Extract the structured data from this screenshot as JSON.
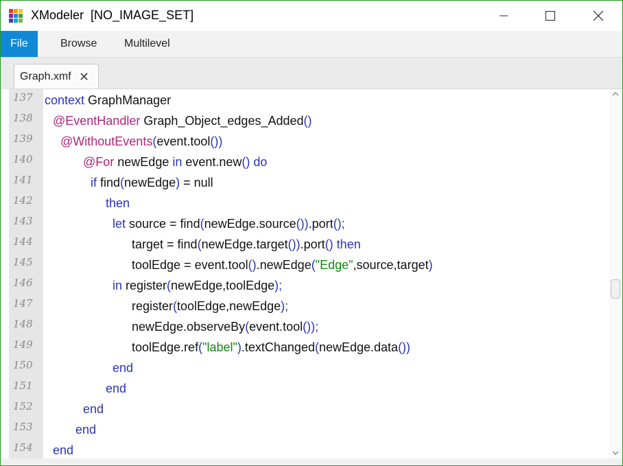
{
  "window": {
    "title": "XModeler  [NO_IMAGE_SET]",
    "accent": "#1e9a1e"
  },
  "menubar": {
    "items": [
      {
        "label": "File",
        "active": true
      },
      {
        "label": "Browse",
        "active": false
      },
      {
        "label": "Multilevel",
        "active": false
      }
    ],
    "active_color": "#1188d6"
  },
  "tabs": [
    {
      "label": "Graph.xmf",
      "close": "✕"
    }
  ],
  "editor": {
    "colors": {
      "keyword": "#2a33b8",
      "annotation": "#b0237a",
      "string": "#118811"
    },
    "lines": [
      {
        "num": "137",
        "tokens": [
          {
            "t": "kw",
            "v": "context "
          },
          {
            "t": "id",
            "v": "GraphManager"
          }
        ]
      },
      {
        "num": "138",
        "tokens": [
          {
            "t": "pk",
            "v": "@EventHandler "
          },
          {
            "t": "id",
            "v": "Graph_Object_edges_Added"
          },
          {
            "t": "kw",
            "v": "()"
          }
        ]
      },
      {
        "num": "139",
        "tokens": [
          {
            "t": "pk",
            "v": "@WithoutEvents"
          },
          {
            "t": "kw",
            "v": "("
          },
          {
            "t": "id",
            "v": "event.tool"
          },
          {
            "t": "kw",
            "v": "())"
          }
        ]
      },
      {
        "num": "140",
        "tokens": [
          {
            "t": "pk",
            "v": "@For "
          },
          {
            "t": "id",
            "v": "newEdge "
          },
          {
            "t": "kw",
            "v": "in "
          },
          {
            "t": "id",
            "v": "event.new"
          },
          {
            "t": "kw",
            "v": "() do"
          }
        ]
      },
      {
        "num": "141",
        "tokens": [
          {
            "t": "kw",
            "v": "if "
          },
          {
            "t": "id",
            "v": "find"
          },
          {
            "t": "kw",
            "v": "("
          },
          {
            "t": "id",
            "v": "newEdge"
          },
          {
            "t": "kw",
            "v": ")"
          },
          {
            "t": "id",
            "v": " = null"
          }
        ]
      },
      {
        "num": "142",
        "tokens": [
          {
            "t": "kw",
            "v": "then"
          }
        ]
      },
      {
        "num": "143",
        "tokens": [
          {
            "t": "kw",
            "v": "let "
          },
          {
            "t": "id",
            "v": "source = find"
          },
          {
            "t": "kw",
            "v": "("
          },
          {
            "t": "id",
            "v": "newEdge.source"
          },
          {
            "t": "kw",
            "v": "())"
          },
          {
            "t": "id",
            "v": ".port"
          },
          {
            "t": "kw",
            "v": "();"
          }
        ]
      },
      {
        "num": "144",
        "tokens": [
          {
            "t": "id",
            "v": "target = find"
          },
          {
            "t": "kw",
            "v": "("
          },
          {
            "t": "id",
            "v": "newEdge.target"
          },
          {
            "t": "kw",
            "v": "())"
          },
          {
            "t": "id",
            "v": ".port"
          },
          {
            "t": "kw",
            "v": "() then"
          }
        ]
      },
      {
        "num": "145",
        "tokens": [
          {
            "t": "id",
            "v": "toolEdge = event.tool"
          },
          {
            "t": "kw",
            "v": "()"
          },
          {
            "t": "id",
            "v": ".newEdge"
          },
          {
            "t": "kw",
            "v": "("
          },
          {
            "t": "str",
            "v": "\"Edge\""
          },
          {
            "t": "id",
            "v": ",source,target"
          },
          {
            "t": "kw",
            "v": ")"
          }
        ]
      },
      {
        "num": "146",
        "tokens": [
          {
            "t": "kw",
            "v": "in "
          },
          {
            "t": "id",
            "v": "register"
          },
          {
            "t": "kw",
            "v": "("
          },
          {
            "t": "id",
            "v": "newEdge,toolEdge"
          },
          {
            "t": "kw",
            "v": ");"
          }
        ]
      },
      {
        "num": "147",
        "tokens": [
          {
            "t": "id",
            "v": "register"
          },
          {
            "t": "kw",
            "v": "("
          },
          {
            "t": "id",
            "v": "toolEdge,newEdge"
          },
          {
            "t": "kw",
            "v": ");"
          }
        ]
      },
      {
        "num": "148",
        "tokens": [
          {
            "t": "id",
            "v": "newEdge.observeBy"
          },
          {
            "t": "kw",
            "v": "("
          },
          {
            "t": "id",
            "v": "event.tool"
          },
          {
            "t": "kw",
            "v": "());"
          }
        ]
      },
      {
        "num": "149",
        "tokens": [
          {
            "t": "id",
            "v": "toolEdge.ref"
          },
          {
            "t": "kw",
            "v": "("
          },
          {
            "t": "str",
            "v": "\"label\""
          },
          {
            "t": "kw",
            "v": ")"
          },
          {
            "t": "id",
            "v": ".textChanged"
          },
          {
            "t": "kw",
            "v": "("
          },
          {
            "t": "id",
            "v": "newEdge.data"
          },
          {
            "t": "kw",
            "v": "())"
          }
        ]
      },
      {
        "num": "150",
        "tokens": [
          {
            "t": "kw",
            "v": "end"
          }
        ]
      },
      {
        "num": "151",
        "tokens": [
          {
            "t": "kw",
            "v": "end"
          }
        ]
      },
      {
        "num": "152",
        "tokens": [
          {
            "t": "kw",
            "v": "end"
          }
        ]
      },
      {
        "num": "153",
        "tokens": [
          {
            "t": "kw",
            "v": "end"
          }
        ]
      },
      {
        "num": "154",
        "tokens": [
          {
            "t": "kw",
            "v": "end"
          }
        ]
      }
    ]
  }
}
